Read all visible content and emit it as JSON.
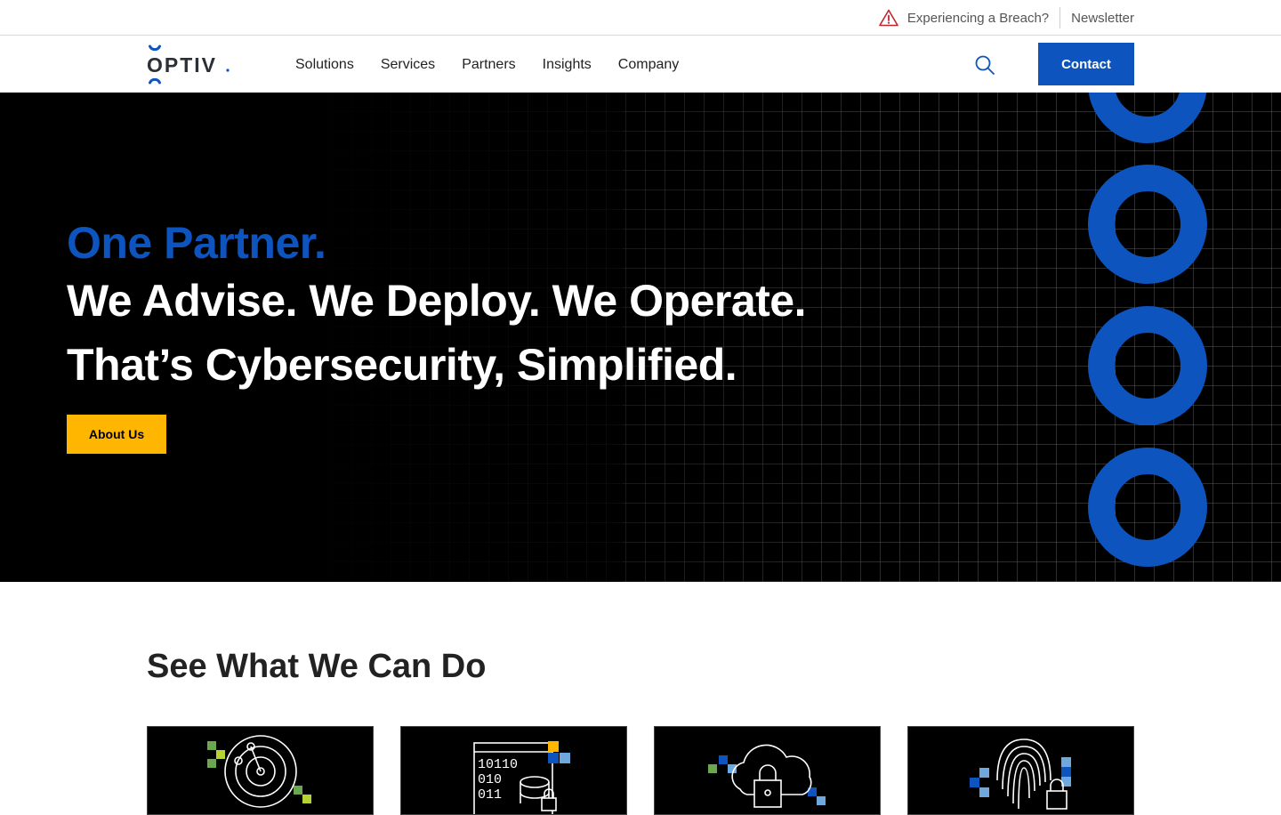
{
  "utility": {
    "breach_label": "Experiencing a Breach?",
    "newsletter_label": "Newsletter"
  },
  "header": {
    "logo_text": "OPTIV.",
    "nav": [
      "Solutions",
      "Services",
      "Partners",
      "Insights",
      "Company"
    ],
    "contact_label": "Contact",
    "search_icon": "search-icon"
  },
  "hero": {
    "eyebrow": "One Partner.",
    "line1": "We Advise. We Deploy. We Operate.",
    "line2": "That’s Cybersecurity, Simplified.",
    "cta_label": "About Us"
  },
  "section": {
    "title": "See What We Can Do",
    "cards": [
      {
        "icon": "radar-icon"
      },
      {
        "icon": "data-lock-icon",
        "binary": [
          "10110",
          "010",
          "011"
        ]
      },
      {
        "icon": "cloud-lock-icon"
      },
      {
        "icon": "fingerprint-lock-icon"
      }
    ]
  },
  "colors": {
    "brand_blue": "#0d54bf",
    "cta_yellow": "#ffb600",
    "hero_bg": "#000000",
    "breach_red": "#c0262d"
  }
}
